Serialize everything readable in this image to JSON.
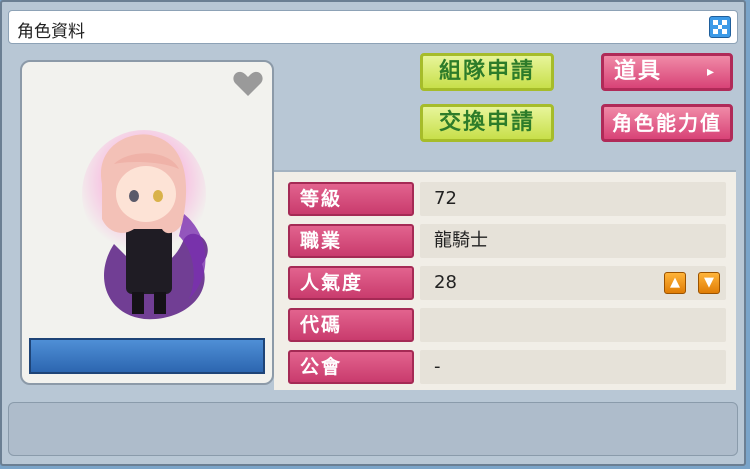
{
  "window": {
    "title": "角色資料"
  },
  "buttons": {
    "party_request": "組隊申請",
    "trade_request": "交換申請",
    "items": "道具",
    "items_arrow": "▸",
    "stats": "角色能力值"
  },
  "info": {
    "rows": [
      {
        "label": "等級",
        "value": "72"
      },
      {
        "label": "職業",
        "value": "龍騎士"
      },
      {
        "label": "人氣度",
        "value": "28"
      },
      {
        "label": "代碼",
        "value": ""
      },
      {
        "label": "公會",
        "value": "-"
      }
    ],
    "fame_up": "▲",
    "fame_down": "▼"
  },
  "colors": {
    "accent_pink": "#d84377",
    "accent_yellow": "#c8df4a",
    "close_blue": "#3d9be8"
  }
}
